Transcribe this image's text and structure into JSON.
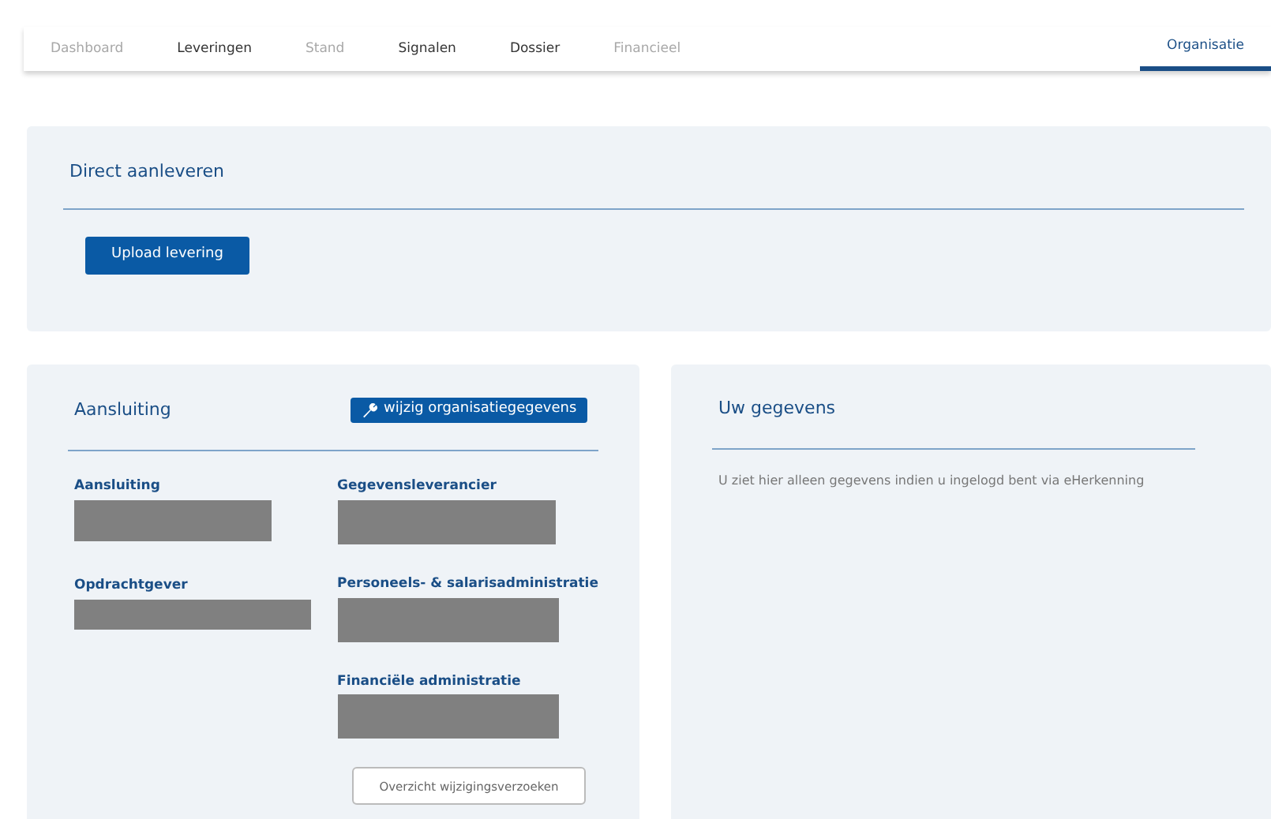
{
  "tabs": [
    {
      "label": "Dashboard",
      "selected": false,
      "disabled": true
    },
    {
      "label": "Leveringen",
      "selected": false,
      "disabled": false
    },
    {
      "label": "Stand",
      "selected": false,
      "disabled": true
    },
    {
      "label": "Signalen",
      "selected": false,
      "disabled": false
    },
    {
      "label": "Dossier",
      "selected": false,
      "disabled": false
    },
    {
      "label": "Financieel",
      "selected": false,
      "disabled": true
    },
    {
      "label": "Organisatie",
      "selected": true,
      "disabled": false
    }
  ],
  "direct": {
    "title": "Direct aanleveren",
    "button": "Upload levering"
  },
  "aansluiting": {
    "title": "Aansluiting",
    "edit_button": "wijzig organisatiegegevens",
    "fields_left": [
      {
        "label": "Aansluiting"
      },
      {
        "label": "Opdrachtgever"
      }
    ],
    "fields_right": [
      {
        "label": "Gegevensleverancier"
      },
      {
        "label": "Personeels- & salarisadministratie"
      },
      {
        "label": "Financiële administratie"
      }
    ],
    "overview_button": "Overzicht wijzigingsverzoeken"
  },
  "gegevens": {
    "title": "Uw gegevens",
    "text": "U ziet hier alleen gegevens indien u ingelogd bent via eHerkenning"
  }
}
